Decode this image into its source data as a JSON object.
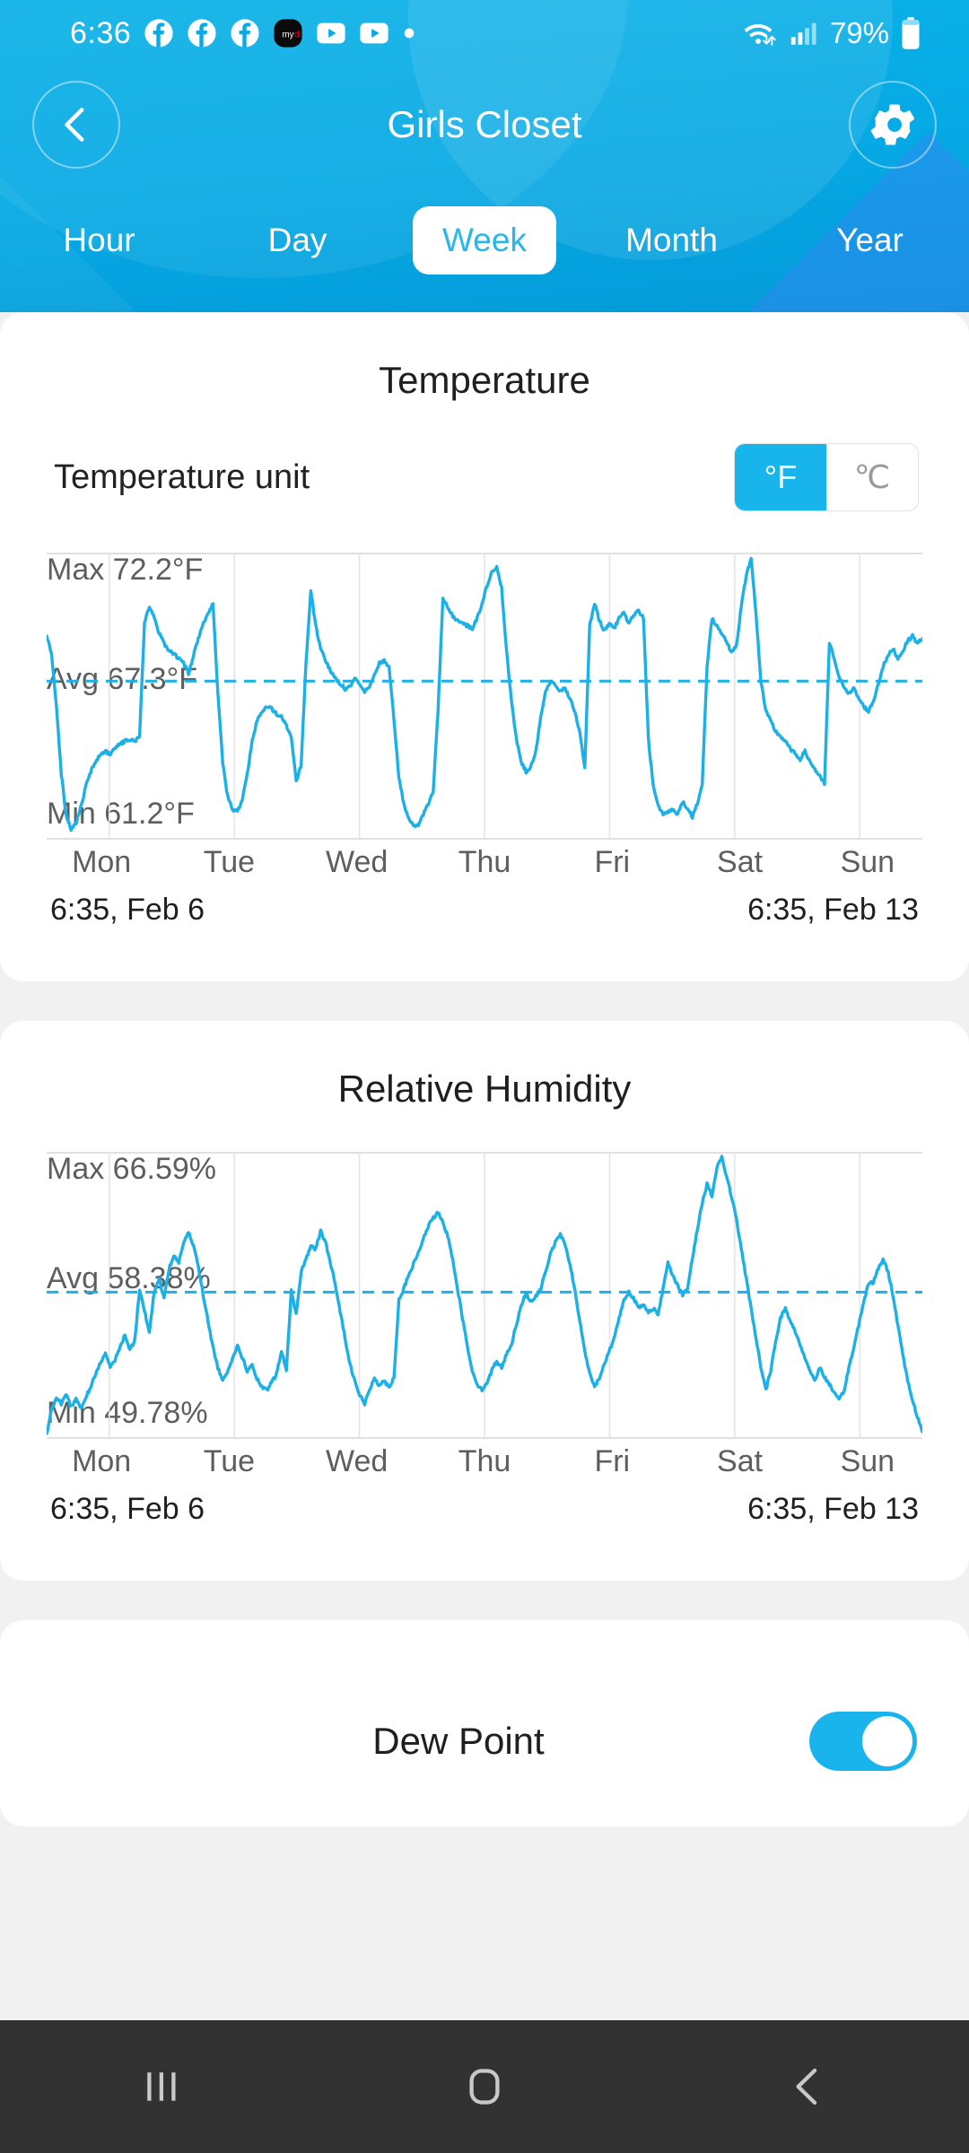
{
  "statusbar": {
    "clock": "6:36",
    "battery_percent": "79%",
    "icons": [
      "facebook-icon",
      "facebook-icon",
      "facebook-icon",
      "mydish-icon",
      "youtube-icon",
      "youtube-icon",
      "dot-icon"
    ],
    "right_icons": [
      "wifi-icon",
      "cellular-signal-icon",
      "battery-icon"
    ]
  },
  "header": {
    "title": "Girls Closet",
    "back_icon": "chevron-left-icon",
    "settings_icon": "gear-icon",
    "accent": "#06a9e4"
  },
  "tabs": [
    {
      "label": "Hour",
      "active": false
    },
    {
      "label": "Day",
      "active": false
    },
    {
      "label": "Week",
      "active": true
    },
    {
      "label": "Month",
      "active": false
    },
    {
      "label": "Year",
      "active": false
    }
  ],
  "temperature_card": {
    "title": "Temperature",
    "unit_label": "Temperature unit",
    "unit_options": [
      "°F",
      "℃"
    ],
    "unit_selected": "°F",
    "max_label": "Max 72.2°F",
    "avg_label": "Avg 67.3°F",
    "min_label": "Min 61.2°F",
    "range_start": "6:35,  Feb 6",
    "range_end": "6:35,  Feb 13"
  },
  "humidity_card": {
    "title": "Relative Humidity",
    "max_label": "Max 66.59%",
    "avg_label": "Avg 58.38%",
    "min_label": "Min 49.78%",
    "range_start": "6:35,  Feb 6",
    "range_end": "6:35,  Feb 13"
  },
  "dew_card": {
    "title": "Dew Point",
    "toggle_on": true
  },
  "navbar": {
    "recents_icon": "recents-icon",
    "home_icon": "home-icon",
    "back_icon": "back-icon"
  },
  "chart_data": [
    {
      "type": "line",
      "title": "Temperature",
      "xlabel": "",
      "ylabel": "°F",
      "unit": "°F",
      "categories": [
        "Mon",
        "Tue",
        "Wed",
        "Thu",
        "Fri",
        "Sat",
        "Sun"
      ],
      "tick_labels": [
        "Mon",
        "Tue",
        "Wed",
        "Thu",
        "Fri",
        "Sat",
        "Sun"
      ],
      "range_start": "6:35,  Feb 6",
      "range_end": "6:35,  Feb 13",
      "max": 72.2,
      "avg": 67.3,
      "min": 61.2,
      "ylim": [
        61.2,
        72.2
      ],
      "grid": true,
      "legend": "none",
      "avg_line": true,
      "line_color": "#1cb0e6",
      "series": [
        {
          "name": "Temperature",
          "values": [
            69.1,
            68.4,
            66.3,
            63.6,
            61.9,
            61.4,
            61.6,
            62.3,
            63.1,
            63.7,
            64.1,
            64.4,
            64.5,
            64.4,
            64.6,
            64.8,
            64.9,
            65.0,
            64.9,
            65.1,
            69.6,
            70.3,
            69.8,
            69.2,
            68.8,
            68.5,
            68.4,
            68.2,
            68.0,
            67.6,
            68.3,
            69.0,
            69.6,
            70.0,
            70.4,
            66.8,
            64.0,
            62.7,
            62.2,
            62.1,
            62.6,
            63.6,
            64.9,
            65.7,
            66.1,
            66.3,
            66.2,
            66.0,
            65.9,
            65.5,
            65.1,
            63.3,
            63.9,
            68.0,
            70.9,
            69.5,
            68.6,
            68.1,
            67.7,
            67.4,
            67.2,
            67.0,
            67.1,
            67.4,
            67.2,
            66.9,
            67.1,
            67.6,
            68.0,
            68.1,
            67.9,
            65.7,
            63.5,
            62.4,
            61.8,
            61.5,
            61.6,
            62.0,
            62.4,
            62.9,
            66.1,
            70.6,
            70.2,
            69.9,
            69.7,
            69.6,
            69.5,
            69.4,
            69.8,
            70.4,
            71.1,
            71.6,
            71.9,
            71.0,
            68.5,
            66.5,
            65.0,
            64.1,
            63.7,
            63.9,
            64.5,
            65.9,
            66.9,
            67.3,
            67.1,
            66.9,
            67.0,
            66.6,
            66.1,
            65.2,
            63.8,
            69.5,
            70.4,
            69.7,
            69.3,
            69.6,
            69.4,
            69.8,
            70.0,
            69.6,
            69.9,
            70.1,
            69.8,
            65.0,
            63.1,
            62.3,
            62.0,
            62.1,
            62.2,
            62.0,
            62.5,
            62.2,
            61.9,
            62.4,
            63.2,
            67.9,
            69.8,
            69.5,
            69.2,
            68.9,
            68.4,
            68.7,
            70.3,
            71.5,
            72.2,
            70.0,
            67.3,
            66.1,
            65.7,
            65.3,
            65.1,
            64.9,
            64.6,
            64.4,
            64.2,
            64.5,
            64.1,
            63.8,
            63.5,
            63.2,
            68.8,
            68.2,
            67.4,
            67.1,
            66.8,
            67.0,
            66.6,
            66.3,
            66.1,
            66.5,
            67.2,
            67.9,
            68.3,
            68.6,
            68.2,
            68.5,
            68.9,
            69.1,
            68.8,
            69.0
          ]
        }
      ]
    },
    {
      "type": "line",
      "title": "Relative Humidity",
      "xlabel": "",
      "ylabel": "%",
      "unit": "%",
      "categories": [
        "Mon",
        "Tue",
        "Wed",
        "Thu",
        "Fri",
        "Sat",
        "Sun"
      ],
      "tick_labels": [
        "Mon",
        "Tue",
        "Wed",
        "Thu",
        "Fri",
        "Sat",
        "Sun"
      ],
      "range_start": "6:35,  Feb 6",
      "range_end": "6:35,  Feb 13",
      "max": 66.59,
      "avg": 58.38,
      "min": 49.78,
      "ylim": [
        49.78,
        66.59
      ],
      "grid": true,
      "legend": "none",
      "avg_line": true,
      "line_color": "#1cb0e6",
      "series": [
        {
          "name": "Relative Humidity",
          "values": [
            49.78,
            51.2,
            52.0,
            51.6,
            52.1,
            51.4,
            51.9,
            51.3,
            52.0,
            52.6,
            53.4,
            54.1,
            54.6,
            53.9,
            54.3,
            55.0,
            55.8,
            54.9,
            55.4,
            58.6,
            57.2,
            56.0,
            58.4,
            59.2,
            58.0,
            59.8,
            60.6,
            60.2,
            61.4,
            62.0,
            61.2,
            60.0,
            58.2,
            56.6,
            55.0,
            53.8,
            53.0,
            53.6,
            54.4,
            55.1,
            54.4,
            53.6,
            53.9,
            53.1,
            52.6,
            52.4,
            52.9,
            53.4,
            54.8,
            53.6,
            58.5,
            57.0,
            59.6,
            60.4,
            61.2,
            61.0,
            62.1,
            61.4,
            60.2,
            58.8,
            57.2,
            55.6,
            54.0,
            53.0,
            52.1,
            51.6,
            52.4,
            53.2,
            52.7,
            53.0,
            52.6,
            53.2,
            57.9,
            58.6,
            59.4,
            60.1,
            60.8,
            61.6,
            62.4,
            62.9,
            63.2,
            62.6,
            61.8,
            60.4,
            58.6,
            56.8,
            55.1,
            53.6,
            52.8,
            52.4,
            52.9,
            53.6,
            54.2,
            53.8,
            54.6,
            55.2,
            56.4,
            57.6,
            58.3,
            57.8,
            58.1,
            58.6,
            59.6,
            60.8,
            61.4,
            61.9,
            61.2,
            60.1,
            58.4,
            56.6,
            54.8,
            53.4,
            52.6,
            53.2,
            54.0,
            54.8,
            55.6,
            56.8,
            57.9,
            58.4,
            58.0,
            57.4,
            57.6,
            57.2,
            57.4,
            57.0,
            58.6,
            60.2,
            59.4,
            58.8,
            58.2,
            58.6,
            60.4,
            62.2,
            63.8,
            65.0,
            64.2,
            66.0,
            66.59,
            65.4,
            64.2,
            62.8,
            61.0,
            59.2,
            57.4,
            55.6,
            53.8,
            52.4,
            53.6,
            55.4,
            56.8,
            57.4,
            56.6,
            56.0,
            55.2,
            54.4,
            53.6,
            53.0,
            53.8,
            53.2,
            52.8,
            52.2,
            51.8,
            52.4,
            53.8,
            55.0,
            56.4,
            57.8,
            58.9,
            59.0,
            59.8,
            60.4,
            59.6,
            58.2,
            56.4,
            54.6,
            53.0,
            51.8,
            50.8,
            49.9
          ]
        }
      ]
    }
  ]
}
